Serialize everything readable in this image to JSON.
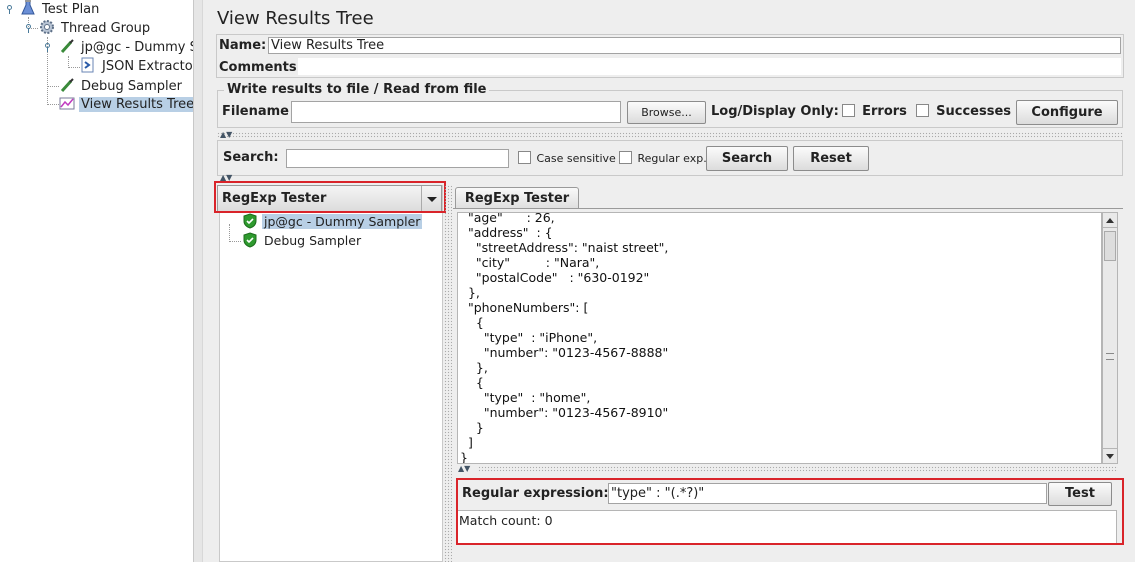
{
  "tree": {
    "items": [
      {
        "label": "Test Plan",
        "icon": "test-plan-icon"
      },
      {
        "label": "Thread Group",
        "icon": "gear-icon"
      },
      {
        "label": "jp@gc - Dummy Sa",
        "icon": "sampler-pipette-icon"
      },
      {
        "label": "JSON Extractor",
        "icon": "extractor-icon"
      },
      {
        "label": "Debug Sampler",
        "icon": "sampler-pipette-icon"
      },
      {
        "label": "View Results Tree",
        "icon": "listener-graph-icon"
      }
    ]
  },
  "header": {
    "title": "View Results Tree",
    "name_label": "Name:",
    "name_value": "View Results Tree",
    "comments_label": "Comments:"
  },
  "file_section": {
    "legend": "Write results to file / Read from file",
    "filename_label": "Filename",
    "filename_value": "",
    "browse_label": "Browse...",
    "log_display_label": "Log/Display Only:",
    "errors_label": "Errors",
    "successes_label": "Successes",
    "configure_label": "Configure"
  },
  "search": {
    "label": "Search:",
    "value": "",
    "case_sensitive_label": "Case sensitive",
    "regular_exp_label": "Regular exp.",
    "search_button": "Search",
    "reset_button": "Reset"
  },
  "renderer": {
    "selected": "RegExp Tester"
  },
  "results": {
    "items": [
      {
        "label": "jp@gc - Dummy Sampler",
        "status": "success"
      },
      {
        "label": "Debug Sampler",
        "status": "success"
      }
    ]
  },
  "tab": {
    "label": "RegExp Tester"
  },
  "response_body": "  \"age\"      : 26,\n  \"address\"  : {\n    \"streetAddress\": \"naist street\",\n    \"city\"         : \"Nara\",\n    \"postalCode\"   : \"630-0192\"\n  },\n  \"phoneNumbers\": [\n    {\n      \"type\"  : \"iPhone\",\n      \"number\": \"0123-4567-8888\"\n    },\n    {\n      \"type\"  : \"home\",\n      \"number\": \"0123-4567-8910\"\n    }\n  ]\n}",
  "regex": {
    "label": "Regular expression:",
    "value": "\"type\" : \"(.*?)\"",
    "test_button": "Test",
    "result": "Match count: 0"
  },
  "colors": {
    "highlight": "#d9242a",
    "selection": "#b8cfe5",
    "success_shield": "#2e9a2e"
  }
}
